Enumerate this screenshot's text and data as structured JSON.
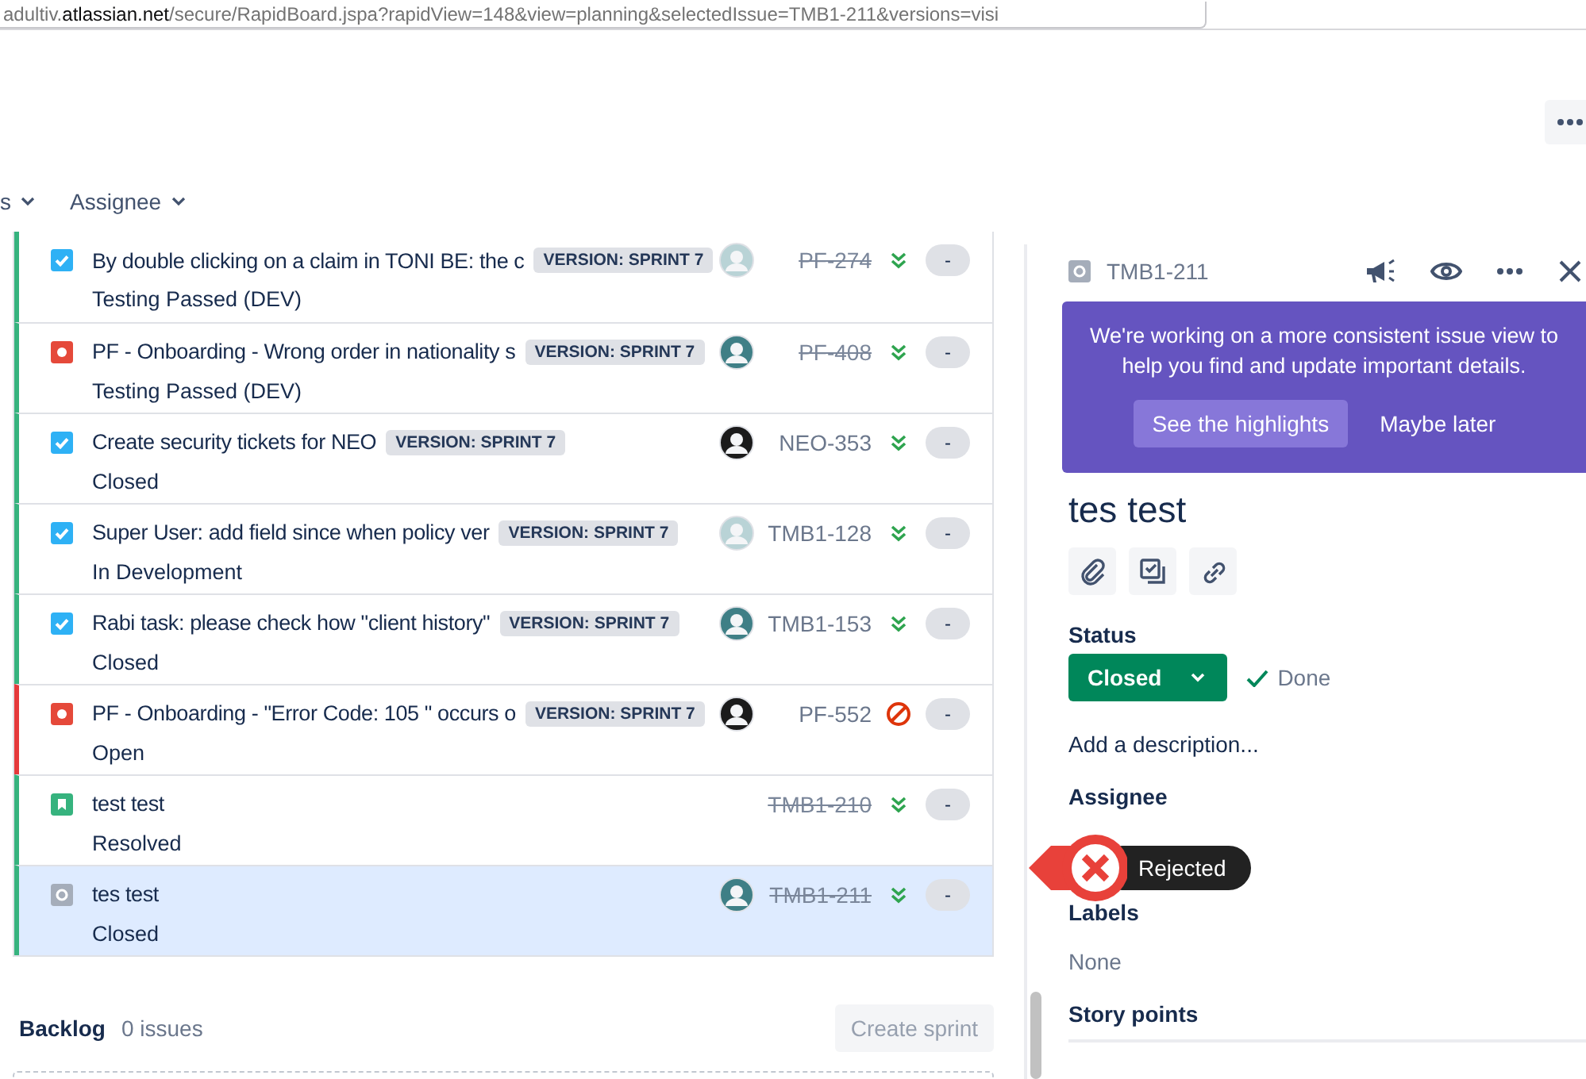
{
  "browser": {
    "url_host_prefix": "adultiv.",
    "url_host": "atlassian.net",
    "url_path": "/secure/RapidBoard.jspa?rapidView=148&view=planning&selectedIssue=TMB1-211&versions=visi"
  },
  "filters": [
    {
      "label": "s"
    },
    {
      "label": "Assignee"
    }
  ],
  "issues": [
    {
      "kind": "task",
      "title": "By double clicking on a claim in TONI BE: the c",
      "tag": "VERSION: SPRINT 7",
      "avatar": true,
      "key": "PF-274",
      "done": true,
      "blocked": false,
      "status": "Testing Passed (DEV)",
      "estimate": "-",
      "color": "#36b37e",
      "selected": false
    },
    {
      "kind": "bug",
      "title": "PF - Onboarding - Wrong order in nationality s",
      "tag": "VERSION: SPRINT 7",
      "avatar": true,
      "key": "PF-408",
      "done": true,
      "blocked": false,
      "status": "Testing Passed (DEV)",
      "estimate": "-",
      "color": "#36b37e",
      "selected": false
    },
    {
      "kind": "task",
      "title": "Create security tickets for NEO",
      "tag": "VERSION: SPRINT 7",
      "avatar": true,
      "key": "NEO-353",
      "done": false,
      "blocked": false,
      "status": "Closed",
      "estimate": "-",
      "color": "#36b37e",
      "selected": false
    },
    {
      "kind": "task",
      "title": "Super User: add field since when policy ver",
      "tag": "VERSION: SPRINT 7",
      "avatar": true,
      "key": "TMB1-128",
      "done": false,
      "blocked": false,
      "status": "In Development",
      "estimate": "-",
      "color": "#36b37e",
      "selected": false
    },
    {
      "kind": "task",
      "title": "Rabi task: please check how \"client history\"",
      "tag": "VERSION: SPRINT 7",
      "avatar": true,
      "key": "TMB1-153",
      "done": false,
      "blocked": false,
      "status": "Closed",
      "estimate": "-",
      "color": "#36b37e",
      "selected": false
    },
    {
      "kind": "bug",
      "title": "PF - Onboarding - \"Error Code: 105 \" occurs o",
      "tag": "VERSION: SPRINT 7",
      "avatar": true,
      "key": "PF-552",
      "done": false,
      "blocked": true,
      "status": "Open",
      "estimate": "-",
      "color": "#e5393b",
      "selected": false
    },
    {
      "kind": "story",
      "title": "test test",
      "avatar": false,
      "key": "TMB1-210",
      "done": true,
      "blocked": false,
      "status": "Resolved",
      "estimate": "-",
      "color": "#36b37e",
      "selected": false
    },
    {
      "kind": "subtask",
      "title": "tes test",
      "avatar": true,
      "key": "TMB1-211",
      "done": true,
      "blocked": false,
      "status": "Closed",
      "estimate": "-",
      "color": "#36b37e",
      "selected": true
    }
  ],
  "backlog": {
    "title": "Backlog",
    "count": "0 issues",
    "button": {
      "label": "Create sprint",
      "disabled": true
    }
  },
  "detail": {
    "kind": "subtask",
    "key": "TMB1-211",
    "banner": {
      "text": "We're working on a more consistent issue view to help you find and update important details.",
      "primary": "See the highlights",
      "secondary": "Maybe later"
    },
    "title": "tes test",
    "status_label": "Status",
    "status": "Closed",
    "resolution": "Done",
    "description_placeholder": "Add a description...",
    "assignee_label": "Assignee",
    "labels_label": "Labels",
    "labels_value": "None",
    "story_points_label": "Story points"
  },
  "annotation": {
    "label": "Rejected"
  }
}
